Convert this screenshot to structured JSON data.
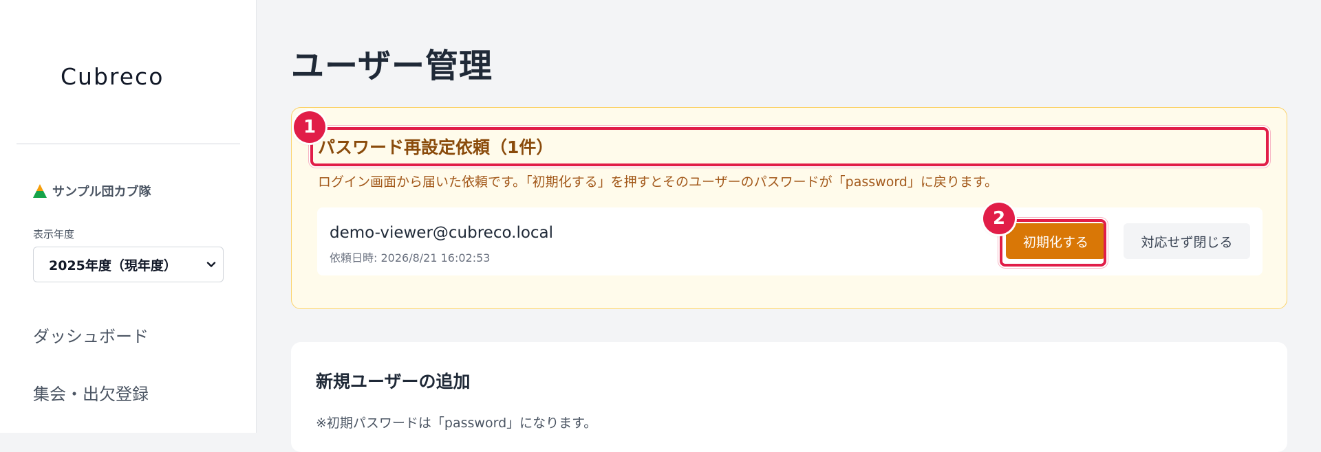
{
  "sidebar": {
    "logo": "Cubreco",
    "troop_name": "サンプル団カブ隊",
    "year_label": "表示年度",
    "year_selected": "2025年度（現年度）",
    "nav": [
      {
        "label": "ダッシュボード"
      },
      {
        "label": "集会・出欠登録"
      }
    ]
  },
  "main": {
    "title": "ユーザー管理",
    "reset_requests": {
      "heading": "パスワード再設定依頼（1件）",
      "description": "ログイン画面から届いた依頼です。「初期化する」を押すとそのユーザーのパスワードが「password」に戻ります。",
      "items": [
        {
          "email": "demo-viewer@cubreco.local",
          "requested_at": "依頼日時: 2026/8/21 16:02:53",
          "reset_label": "初期化する",
          "dismiss_label": "対応せず閉じる"
        }
      ]
    },
    "add_user": {
      "heading": "新規ユーザーの追加",
      "note": "※初期パスワードは「password」になります。"
    }
  },
  "annotations": [
    {
      "number": "1"
    },
    {
      "number": "2"
    }
  ],
  "colors": {
    "accent": "#d97706",
    "highlight": "#e11d48",
    "panel_bg": "#fffbeb",
    "panel_border": "#fbd36a"
  }
}
